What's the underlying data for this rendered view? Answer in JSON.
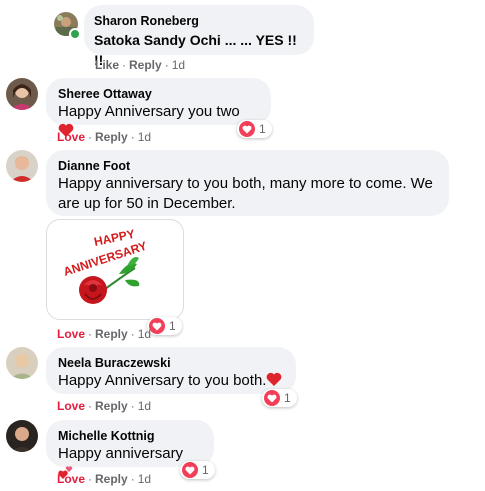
{
  "comments": [
    {
      "author": "Sharon Roneberg",
      "text": "Satoka Sandy Ochi ... ... YES !! !!",
      "action_react": "Like",
      "action_reply": "Reply",
      "time": "1d"
    },
    {
      "author": "Sheree Ottaway",
      "text": "Happy Anniversary you two",
      "action_react": "Love",
      "action_reply": "Reply",
      "time": "1d",
      "reaction_count": "1"
    },
    {
      "author": "Dianne Foot",
      "text_line1": "Happy anniversary to you both, many more to come. We",
      "text_line2": "are up for 50 in December.",
      "action_react": "Love",
      "action_reply": "Reply",
      "time": "1d",
      "reaction_count": "1",
      "gif_text_line1": "HAPPY",
      "gif_text_line2": "ANNIVERSARY"
    },
    {
      "author": "Neela Buraczewski",
      "text": "Happy Anniversary to you both.",
      "action_react": "Love",
      "action_reply": "Reply",
      "time": "1d",
      "reaction_count": "1"
    },
    {
      "author": "Michelle Kottnig",
      "text": "Happy anniversary",
      "action_react": "Love",
      "action_reply": "Reply",
      "time": "1d",
      "reaction_count": "1"
    }
  ],
  "separator": "·",
  "colors": {
    "bubble": "#f0f2f5",
    "love": "#e41e3f",
    "heart": "#f33e58",
    "meta": "#65676b",
    "online": "#31a24c"
  }
}
